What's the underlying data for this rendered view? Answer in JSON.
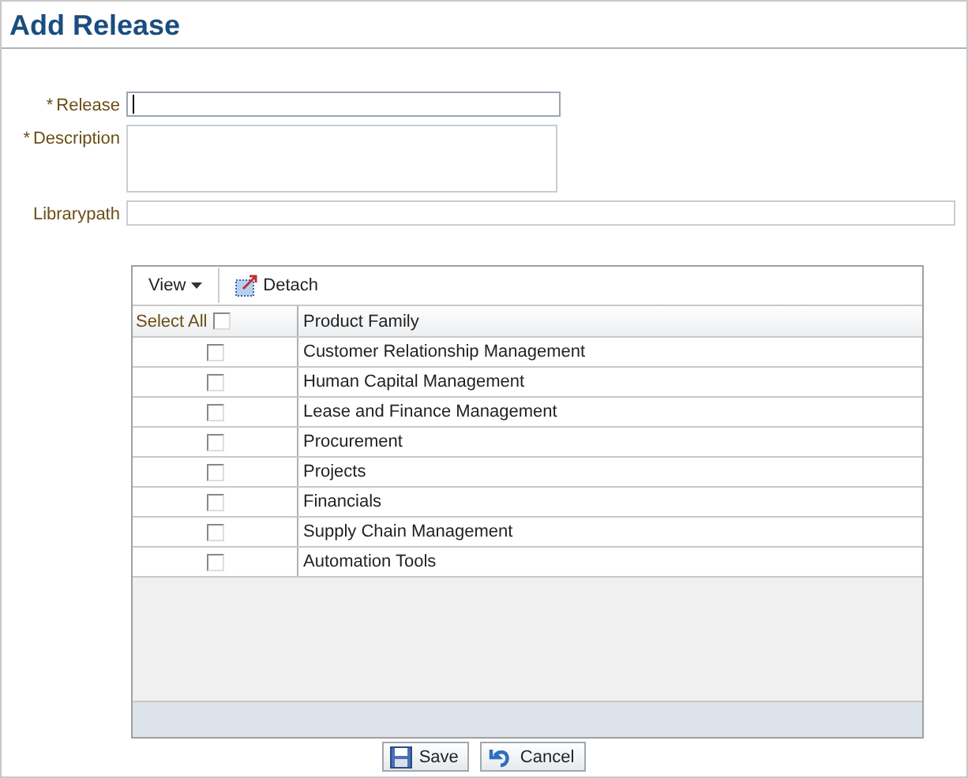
{
  "title": "Add Release",
  "fields": [
    {
      "kind": "input",
      "marker": "*",
      "label": "Release",
      "focused": true
    },
    {
      "kind": "textarea",
      "marker": "*",
      "label": "Description",
      "focused": false
    },
    {
      "kind": "wide",
      "label": "Librarypath",
      "focused": false
    }
  ],
  "toolbar": {
    "view": "View",
    "detach": "Detach"
  },
  "table": {
    "select_all": {
      "label": "Select All",
      "checked": false
    },
    "columns": [
      "Product Family"
    ],
    "rows": [
      {
        "name": "Customer Relationship Management",
        "checked": false
      },
      {
        "name": "Human Capital Management",
        "checked": false
      },
      {
        "name": "Lease and Finance Management",
        "checked": false
      },
      {
        "name": "Procurement",
        "checked": false
      },
      {
        "name": "Projects",
        "checked": false
      },
      {
        "name": "Financials",
        "checked": false
      },
      {
        "name": "Supply Chain Management",
        "checked": false
      },
      {
        "name": "Automation Tools",
        "checked": false
      }
    ]
  },
  "buttons": [
    {
      "kind": "save",
      "label": "Save"
    },
    {
      "kind": "cancel",
      "label": "Cancel"
    }
  ]
}
